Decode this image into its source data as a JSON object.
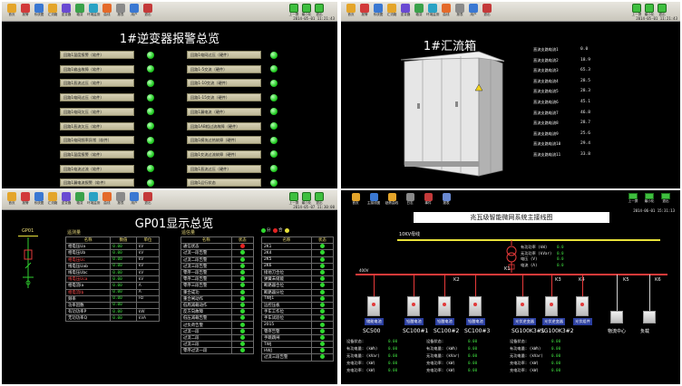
{
  "toolbar": {
    "items": [
      "首页",
      "报警",
      "系统图",
      "汇流箱",
      "逆变器",
      "箱变",
      "环境监测",
      "曲线",
      "报表",
      "用户",
      "退出"
    ],
    "right_items": [
      "上一屏",
      "最小化",
      "退出"
    ],
    "p1_time": "2014-05-01 11:21:43",
    "p2_time": "2014-05-01 11:21:43",
    "p3_time": "2014-05-07 11:30:00"
  },
  "colors": {
    "led_green": "#22cc22",
    "led_red": "#e52222",
    "bus_yellow": "#e8e23a",
    "tag_blue": "#2b3fa0"
  },
  "panel1": {
    "title": "1#逆变器报警总览",
    "left_items": [
      "回路1温度报警（软件）",
      "回路1输出故障（软件）",
      "回路1直流过压（软件）",
      "回路1电网过压（软件）",
      "回路1电网欠压（软件）",
      "回路1直流欠压（软件）",
      "回路1电网频率异常（软件）",
      "回路1温度报警（软件）",
      "回路1电流过流（软件）",
      "回路1漏电流报警（软件）"
    ],
    "right_items": [
      "回路1电网过压（硬件）",
      "回路1-5交流（硬件）",
      "回路1-10交流（硬件）",
      "回路1-15交流（硬件）",
      "回路1漏电流（硬件）",
      "回路1AB相过流故障（硬件）",
      "回路1模块过热故障（硬件）",
      "回路1交流过流故障（硬件）",
      "回路1直流过压（硬件）",
      "回路1运行状态"
    ]
  },
  "panel2": {
    "title": "1#汇流箱",
    "rows": [
      {
        "label": "直流支路电流1",
        "value": "0.0"
      },
      {
        "label": "直流支路电流2",
        "value": "18.9"
      },
      {
        "label": "直流支路电流3",
        "value": "65.3"
      },
      {
        "label": "直流支路电流4",
        "value": "28.5"
      },
      {
        "label": "直流支路电流5",
        "value": "28.3"
      },
      {
        "label": "直流支路电流6",
        "value": "45.1"
      },
      {
        "label": "直流支路电流7",
        "value": "46.8"
      },
      {
        "label": "直流支路电流8",
        "value": "28.7"
      },
      {
        "label": "直流支路电流9",
        "value": "25.6"
      },
      {
        "label": "直流支路电流10",
        "value": "29.4"
      },
      {
        "label": "直流支路电流11",
        "value": "33.8"
      }
    ]
  },
  "panel3": {
    "title": "GP01显示总览",
    "side_label": "GP01",
    "sec1": "遥测量",
    "sec2": "遥信量",
    "legend_a": "分",
    "legend_b": "合",
    "t1_headers": [
      "名称",
      "数值",
      "单位"
    ],
    "t1_rows": [
      {
        "name": "相电压Ua",
        "value": "0.00",
        "unit": "kV",
        "red": false
      },
      {
        "name": "相电压Ub",
        "value": "0.00",
        "unit": "kV",
        "red": false
      },
      {
        "name": "相电压Uc",
        "value": "0.00",
        "unit": "kV",
        "red": true
      },
      {
        "name": "线电压Uab",
        "value": "0.00",
        "unit": "kV",
        "red": false
      },
      {
        "name": "线电压Ubc",
        "value": "0.00",
        "unit": "kV",
        "red": false
      },
      {
        "name": "线电压Uca",
        "value": "0.00",
        "unit": "kV",
        "red": true
      },
      {
        "name": "相电流Ia",
        "value": "0.00",
        "unit": "A",
        "red": false
      },
      {
        "name": "相电流Ib",
        "value": "0.00",
        "unit": "A",
        "red": true
      },
      {
        "name": "频率",
        "value": "0.00",
        "unit": "Hz",
        "red": false
      },
      {
        "name": "功率因数",
        "value": "0.00",
        "unit": "",
        "red": false
      },
      {
        "name": "有功功率P",
        "value": "0.00",
        "unit": "kW",
        "red": false
      },
      {
        "name": "无功功率Q",
        "value": "0.00",
        "unit": "kVA",
        "red": false
      }
    ],
    "t2_headers": [
      "名称",
      "状态"
    ],
    "t2_rows": [
      "通信状态",
      "过流一段告警",
      "过流二段告警",
      "过流三段告警",
      "零序一段告警",
      "零序二段告警",
      "零序三段告警",
      "重合成功",
      "重合闸动作",
      "低周减载动作",
      "反方向故障",
      "低压减载告警",
      "过负荷告警",
      "过流一段",
      "过流二段",
      "过流三段",
      "零序过流一段"
    ],
    "t2_status": [
      "red",
      "g",
      "g",
      "g",
      "g",
      "g",
      "g",
      "g",
      "g",
      "g",
      "g",
      "g",
      "g",
      "g",
      "g",
      "g",
      "g"
    ],
    "t3_headers": [
      "名称",
      "状态"
    ],
    "t3_rows": [
      "2K1",
      "2K4",
      "2K5",
      "2K6",
      "接地刀合位",
      "弹簧未储能",
      "断路器合位",
      "断路器分位",
      "TWJ1",
      "远控压板",
      "手车工作位",
      "手车试验位",
      "2015",
      "零序告警",
      "手跳跳闸",
      "TWJ",
      "HWJ",
      "过流三段告警"
    ],
    "t3_status": [
      "g",
      "g",
      "g",
      "g",
      "g",
      "g",
      "g",
      "g",
      "g",
      "g",
      "g",
      "g",
      "g",
      "g",
      "g",
      "g",
      "g",
      "g"
    ]
  },
  "panel4": {
    "title": "兆瓦级智能微网系统主接线图",
    "toolbar": [
      "首页",
      "主接线图",
      "趋势曲线",
      "日志",
      "事件",
      "报表"
    ],
    "right_toolbar": [
      "上一屏",
      "最小化",
      "退出"
    ],
    "time": "2014-06-01 15:31:13",
    "bus_label": "10KV母线",
    "bus2_label": "400V",
    "k_labels": [
      "K1",
      "K2",
      "K3",
      "K4",
      "K5",
      "K6"
    ],
    "top_readout": [
      {
        "label": "有功功率 (kW)",
        "value": "0.0"
      },
      {
        "label": "无功功率 (kVar)",
        "value": "0.0"
      },
      {
        "label": "电压 (V)",
        "value": "0.0"
      },
      {
        "label": "电流 (A)",
        "value": "0.0"
      }
    ],
    "units": [
      {
        "tag": "储能电池",
        "name": "SC500",
        "ip": "192.168.0.100"
      },
      {
        "tag": "铅酸电池",
        "name": "SC100#1",
        "ip": "192.168.0.101"
      },
      {
        "tag": "铅酸电池",
        "name": "SC100#2",
        "ip": "192.168.0.102"
      },
      {
        "tag": "铅酸电池",
        "name": "SC100#3",
        "ip": "192.168.0.103"
      },
      {
        "tag": "光伏逆变器",
        "name": "SG100K3#1",
        "ip": "192.168.0.104"
      },
      {
        "tag": "光伏逆变器",
        "name": "SG100K3#2",
        "ip": "192.168.0.105"
      },
      {
        "tag": "光伏组件",
        "name": "",
        "ip": ""
      }
    ],
    "right_units": [
      {
        "name": "物流中心"
      },
      {
        "name": "负载"
      }
    ],
    "stat_labels": [
      "设备状态:",
      "有功电量: (kWh)",
      "无功电量: (kVar)",
      "充电功率: (kW)",
      "充电功率: (kW)"
    ],
    "stat_value": "0.00"
  }
}
